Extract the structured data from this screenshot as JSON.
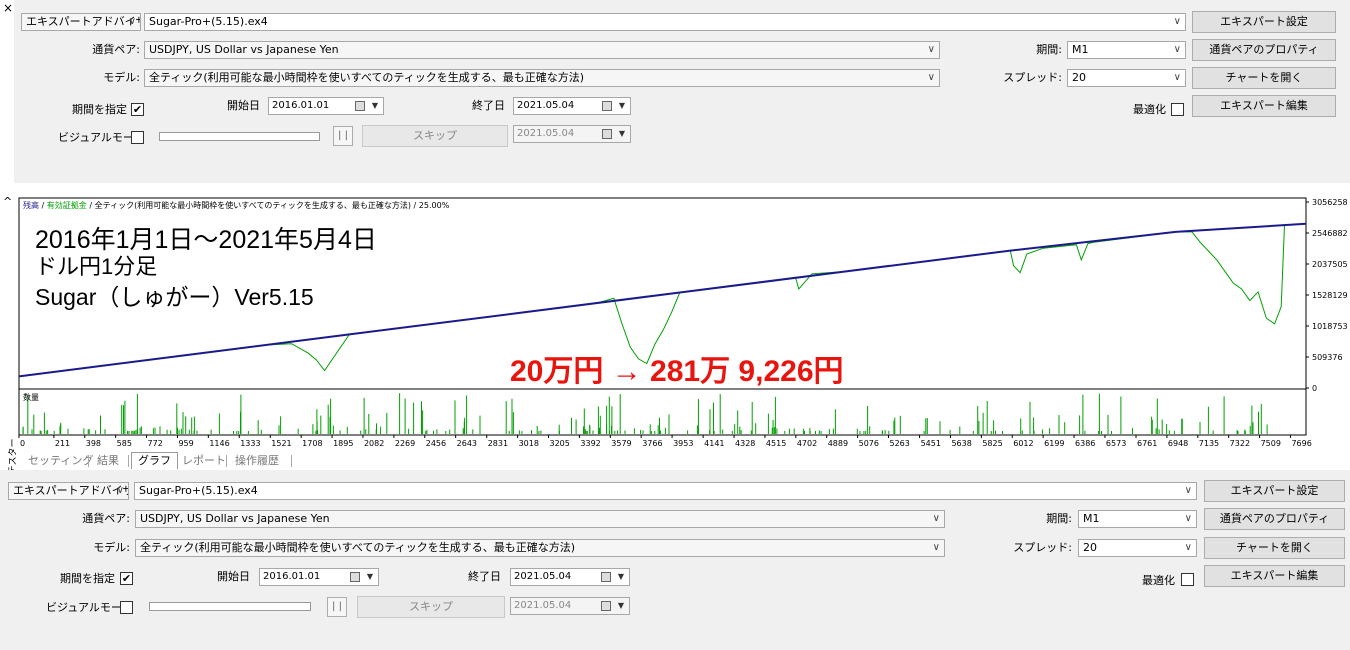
{
  "panel_top": {
    "expert_type": "エキスパートアドバイザ",
    "expert_file": "Sugar-Pro+(5.15).ex4",
    "expert_settings_btn": "エキスパート設定",
    "pair_label": "通貨ペア:",
    "pair_value": "USDJPY, US Dollar vs Japanese Yen",
    "period_label": "期間:",
    "period_value": "M1",
    "pair_props_btn": "通貨ペアのプロパティ",
    "model_label": "モデル:",
    "model_value": "全ティック(利用可能な最小時間枠を使いすべてのティックを生成する、最も正確な方法)",
    "spread_label": "スプレッド:",
    "spread_value": "20",
    "open_chart_btn": "チャートを開く",
    "use_date_label": "期間を指定",
    "use_date_checked": "✔",
    "start_label": "開始日",
    "start_value": "2016.01.01",
    "end_label": "終了日",
    "end_value": "2021.05.04",
    "optimize_label": "最適化",
    "edit_expert_btn": "エキスパート編集",
    "visual_label": "ビジュアルモード",
    "pause_glyph": "| |",
    "skip_btn": "スキップ",
    "skip_date": "2021.05.04"
  },
  "panel_bottom": {
    "expert_type": "エキスパートアドバイザ",
    "expert_file": "Sugar-Pro+(5.15).ex4",
    "expert_settings_btn": "エキスパート設定",
    "pair_label": "通貨ペア:",
    "pair_value": "USDJPY, US Dollar vs Japanese Yen",
    "period_label": "期間:",
    "period_value": "M1",
    "pair_props_btn": "通貨ペアのプロパティ",
    "model_label": "モデル:",
    "model_value": "全ティック(利用可能な最小時間枠を使いすべてのティックを生成する、最も正確な方法)",
    "spread_label": "スプレッド:",
    "spread_value": "20",
    "open_chart_btn": "チャートを開く",
    "use_date_label": "期間を指定",
    "use_date_checked": "✔",
    "start_label": "開始日",
    "start_value": "2016.01.01",
    "end_label": "終了日",
    "end_value": "2021.05.04",
    "optimize_label": "最適化",
    "edit_expert_btn": "エキスパート編集",
    "visual_label": "ビジュアルモード",
    "pause_glyph": "| |",
    "skip_btn": "スキップ",
    "skip_date": "2021.05.04"
  },
  "window_controls": {
    "close_glyph": "×",
    "collapse_glyph": "^"
  },
  "tester_vertical_label": "テスター",
  "tabs": [
    {
      "label": "セッティング",
      "active": false
    },
    {
      "label": "結果",
      "active": false
    },
    {
      "label": "グラフ",
      "active": true
    },
    {
      "label": "レポート",
      "active": false
    },
    {
      "label": "操作履歴",
      "active": false
    }
  ],
  "overlay": {
    "line1": "2016年1月1日～2021年5月4日",
    "line2": "ドル円1分足",
    "line3": "Sugar（しゅがー）Ver5.15",
    "result": "20万円 → 281万 9,226円"
  },
  "chart_data": {
    "type": "line",
    "header_balance": "残高",
    "header_equity": "有効証拠金",
    "header_model": "全ティック(利用可能な最小時間枠を使いすべてのティックを生成する、最も正確な方法)",
    "header_quality": "25.00%",
    "volume_label": "数量",
    "y_ticks": [
      "3056258",
      "2546882",
      "2037505",
      "1528129",
      "1018753",
      "509376",
      "0"
    ],
    "x_ticks": [
      "0",
      "211",
      "398",
      "585",
      "772",
      "959",
      "1146",
      "1333",
      "1521",
      "1708",
      "1895",
      "2082",
      "2269",
      "2456",
      "2643",
      "2831",
      "3018",
      "3205",
      "3392",
      "3579",
      "3766",
      "3953",
      "4141",
      "4328",
      "4515",
      "4702",
      "4889",
      "5076",
      "5263",
      "5451",
      "5638",
      "5825",
      "6012",
      "6199",
      "6386",
      "6573",
      "6761",
      "6948",
      "7135",
      "7322",
      "7509",
      "7696"
    ],
    "ylim": [
      0,
      3056258
    ],
    "xlim": [
      0,
      7790
    ],
    "colors": {
      "balance": "#1a1a8c",
      "equity": "#00a000",
      "volume": "#00a000"
    },
    "series": [
      {
        "name": "残高",
        "x": [
          0,
          1000,
          2000,
          3000,
          4000,
          5000,
          6000,
          7000,
          7790
        ],
        "y": [
          200000,
          560000,
          920000,
          1280000,
          1640000,
          2000000,
          2360000,
          2680000,
          2819226
        ]
      },
      {
        "name": "有効証拠金",
        "x": [
          0,
          1500,
          1650,
          1750,
          1800,
          1850,
          2000,
          3000,
          3500,
          3600,
          3650,
          3700,
          3750,
          3800,
          3850,
          3900,
          3950,
          4000,
          4500,
          4700,
          4720,
          4800,
          5000,
          6000,
          6020,
          6060,
          6100,
          6200,
          6400,
          6430,
          6470,
          6500,
          7000,
          7100,
          7150,
          7250,
          7350,
          7400,
          7450,
          7500,
          7550,
          7600,
          7640,
          7660,
          7790
        ],
        "y": [
          200000,
          740000,
          760000,
          600000,
          480000,
          300000,
          920000,
          1280000,
          1460000,
          1540000,
          1100000,
          700000,
          500000,
          420000,
          760000,
          1000000,
          1300000,
          1640000,
          1820000,
          1900000,
          1700000,
          1960000,
          2000000,
          2360000,
          2100000,
          1980000,
          2300000,
          2400000,
          2460000,
          2200000,
          2480000,
          2500000,
          2680000,
          2680000,
          2500000,
          2200000,
          1800000,
          1700000,
          1500000,
          1650000,
          1200000,
          1100000,
          1400000,
          2800000,
          2819226
        ]
      }
    ]
  }
}
